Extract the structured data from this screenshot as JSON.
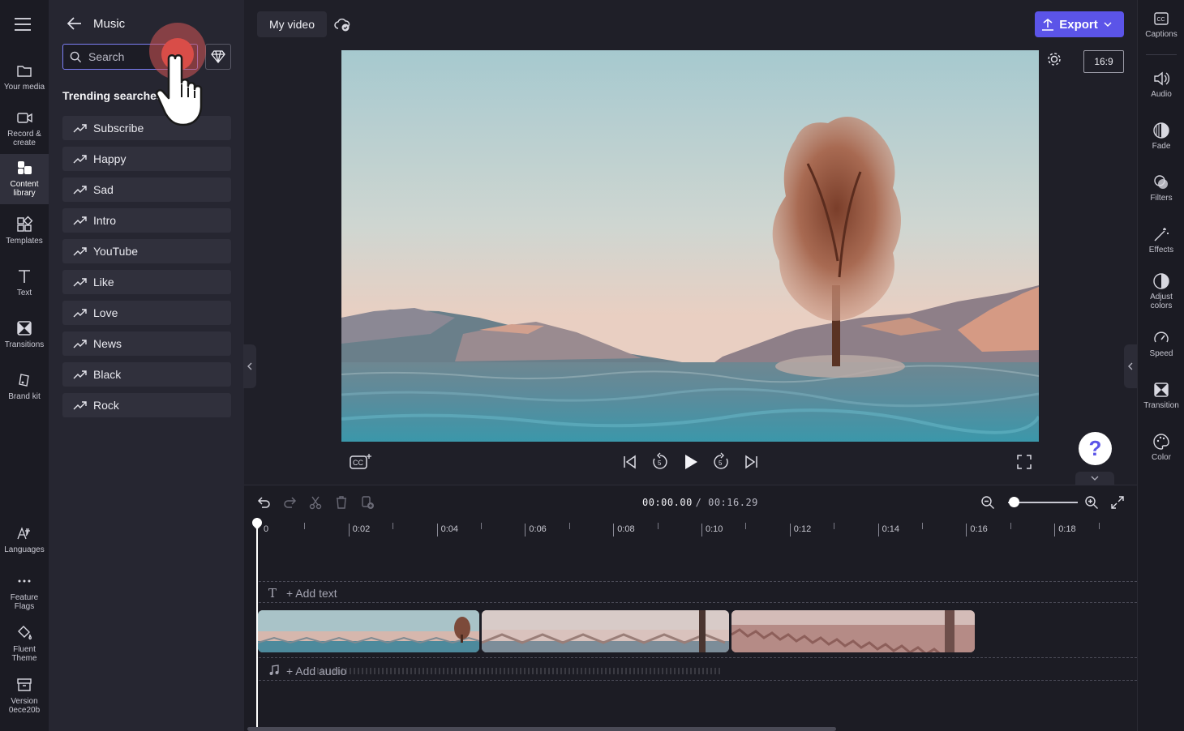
{
  "nav": {
    "items": [
      {
        "label": "Your media",
        "icon": "folder-icon"
      },
      {
        "label": "Record &\ncreate",
        "icon": "camera-icon"
      },
      {
        "label": "Content\nlibrary",
        "icon": "content-library-icon"
      },
      {
        "label": "Templates",
        "icon": "templates-icon"
      },
      {
        "label": "Text",
        "icon": "text-icon"
      },
      {
        "label": "Transitions",
        "icon": "transitions-icon"
      },
      {
        "label": "Brand kit",
        "icon": "brand-kit-icon"
      }
    ],
    "bottom_items": [
      {
        "label": "Languages",
        "icon": "languages-icon"
      },
      {
        "label": "Feature\nFlags",
        "icon": "more-icon"
      },
      {
        "label": "Fluent\nTheme",
        "icon": "paint-bucket-icon"
      },
      {
        "label": "Version\n0ece20b",
        "icon": "archive-icon"
      }
    ]
  },
  "music_panel": {
    "title": "Music",
    "search_placeholder": "Search",
    "trending_title": "Trending searches",
    "trending": [
      "Subscribe",
      "Happy",
      "Sad",
      "Intro",
      "YouTube",
      "Like",
      "Love",
      "News",
      "Black",
      "Rock"
    ]
  },
  "topbar": {
    "project_title": "My video",
    "export_label": "Export",
    "accent": "#5b54e8"
  },
  "preview": {
    "aspect_ratio": "16:9"
  },
  "right_panel": {
    "items": [
      {
        "label": "Captions",
        "icon": "captions-icon"
      },
      {
        "label": "Audio",
        "icon": "speaker-icon"
      },
      {
        "label": "Fade",
        "icon": "fade-icon"
      },
      {
        "label": "Filters",
        "icon": "filters-icon"
      },
      {
        "label": "Effects",
        "icon": "magic-wand-icon"
      },
      {
        "label": "Adjust\ncolors",
        "icon": "contrast-icon"
      },
      {
        "label": "Speed",
        "icon": "speedometer-icon"
      },
      {
        "label": "Transition",
        "icon": "transition-icon"
      },
      {
        "label": "Color",
        "icon": "palette-icon"
      }
    ]
  },
  "timeline": {
    "current_time": "00:00.00",
    "total_time": "/ 00:16.29",
    "ruler_labels": [
      "0",
      "0:02",
      "0:04",
      "0:06",
      "0:08",
      "0:10",
      "0:12",
      "0:14",
      "0:16",
      "0:18"
    ],
    "add_text_label": "+ Add text",
    "add_audio_label": "+ Add audio"
  }
}
